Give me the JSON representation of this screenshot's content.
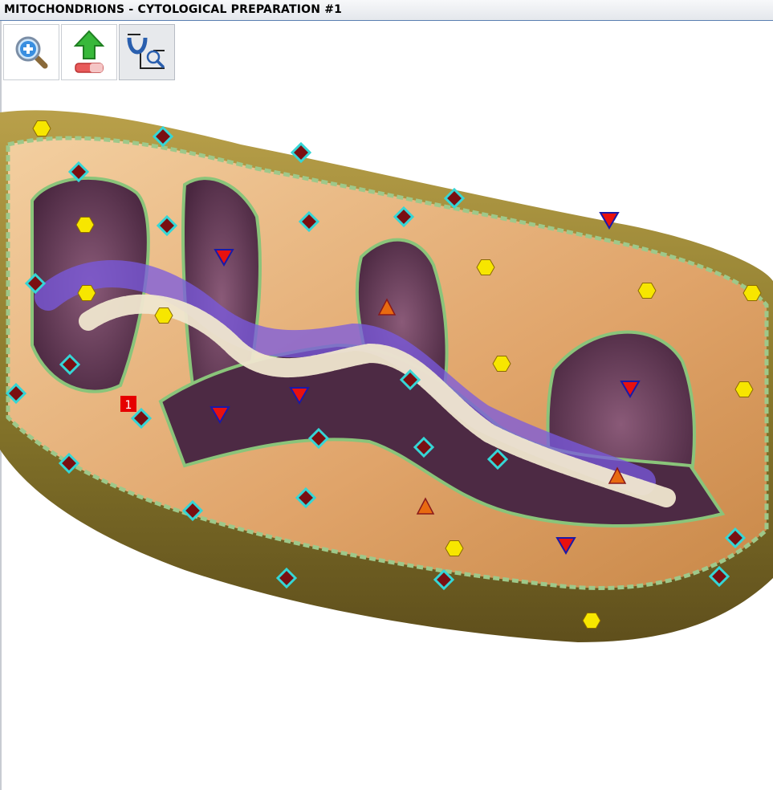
{
  "window": {
    "title": "MITOCHONDRIONS - CYTOLOGICAL PREPARATION #1"
  },
  "toolbar": {
    "tools": [
      {
        "icon": "zoom-in-icon",
        "active": false
      },
      {
        "icon": "upload-erase-icon",
        "active": false
      },
      {
        "icon": "annotation-zoom-icon",
        "active": true
      }
    ]
  },
  "viewer": {
    "label_badge": "1",
    "colors": {
      "hexagon": "#f7e600",
      "diamond": "#7a0f12",
      "diamond_outline": "#35d6d6",
      "triangle_down": "#e8110f",
      "triangle_up": "#e86a10",
      "badge": "#e60000"
    }
  }
}
